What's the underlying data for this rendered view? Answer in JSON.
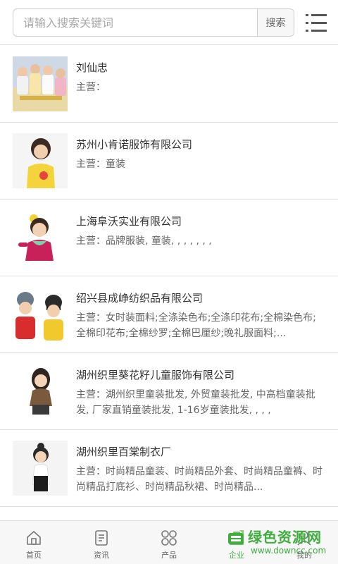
{
  "search": {
    "placeholder": "请输入搜索关键词",
    "button_label": "搜索"
  },
  "companies": [
    {
      "name": "刘仙忠",
      "main": "主营："
    },
    {
      "name": "苏州小肯诺服饰有限公司",
      "main": "主营：童装"
    },
    {
      "name": "上海阜沃实业有限公司",
      "main": "主营：品牌服装, 童装, , , , , , ,"
    },
    {
      "name": "绍兴县成峥纺织品有限公司",
      "main": "主营：女时装面料;全涤染色布;全涤印花布;全棉染色布;全棉印花布;全棉纱罗;全棉巴厘纱;晚礼服面料;..."
    },
    {
      "name": "湖州织里葵花籽儿童服饰有限公司",
      "main": "主营：湖州织里童装批发, 外贸童装批发, 中高档童装批发, 厂家直销童装批发, 1-16岁童装批发, , , ,"
    },
    {
      "name": "湖州织里百棠制衣厂",
      "main": "主营：时尚精品童装、时尚精品外套、时尚精品童裤、时尚精品打底衫、时尚精品秋裙、时尚精品..."
    }
  ],
  "tabs": [
    {
      "label": "首页",
      "icon": "home-icon"
    },
    {
      "label": "资讯",
      "icon": "news-icon"
    },
    {
      "label": "产品",
      "icon": "grid-icon"
    },
    {
      "label": "企业",
      "icon": "company-icon"
    },
    {
      "label": "我的",
      "icon": "user-icon"
    }
  ],
  "active_tab": "企业",
  "watermark": {
    "title": "绿色资源网",
    "url": "www.downcc.com"
  },
  "colors": {
    "accent": "#4caf50",
    "watermark": "#3fae3f",
    "divider": "#dcdcdc"
  }
}
